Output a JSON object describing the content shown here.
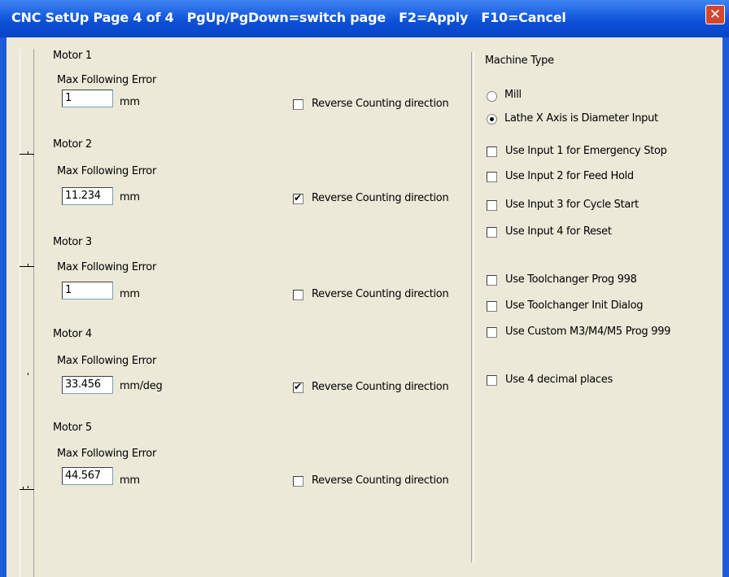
{
  "window": {
    "title": "CNC SetUp Page 4 of 4   PgUp/PgDown=switch page   F2=Apply   F10=Cancel",
    "close_glyph": "✕"
  },
  "motors": [
    {
      "label": "Motor 1",
      "error_label": "Max Following Error",
      "value": "1",
      "unit": "mm",
      "reverse_label": "Reverse Counting direction",
      "reverse_checked": false
    },
    {
      "label": "Motor 2",
      "error_label": "Max Following Error",
      "value": "11.234",
      "unit": "mm",
      "reverse_label": "Reverse Counting direction",
      "reverse_checked": true
    },
    {
      "label": "Motor 3",
      "error_label": "Max Following Error",
      "value": "1",
      "unit": "mm",
      "reverse_label": "Reverse Counting direction",
      "reverse_checked": false
    },
    {
      "label": "Motor 4",
      "error_label": "Max Following Error",
      "value": "33.456",
      "unit": "mm/deg",
      "reverse_label": "Reverse Counting direction",
      "reverse_checked": true
    },
    {
      "label": "Motor 5",
      "error_label": "Max Following Error",
      "value": "44.567",
      "unit": "mm",
      "reverse_label": "Reverse Counting direction",
      "reverse_checked": false
    }
  ],
  "machine": {
    "heading": "Machine Type",
    "mill_label": "Mill",
    "mill_selected": false,
    "lathe_label": "Lathe X Axis is Diameter Input",
    "lathe_selected": true
  },
  "options": [
    {
      "label": "Use Input 1 for Emergency Stop",
      "checked": false
    },
    {
      "label": "Use Input 2 for Feed Hold",
      "checked": false
    },
    {
      "label": "Use Input 3 for Cycle Start",
      "checked": false
    },
    {
      "label": "Use Input 4 for Reset",
      "checked": false
    },
    {
      "label": "Use Toolchanger Prog 998",
      "checked": false
    },
    {
      "label": "Use Toolchanger Init Dialog",
      "checked": false
    },
    {
      "label": "Use Custom M3/M4/M5 Prog 999",
      "checked": false
    },
    {
      "label": "Use 4 decimal places",
      "checked": false
    }
  ],
  "colors": {
    "titlebar": "#0a4fd6",
    "dialog_bg": "#ece9d8",
    "close_button": "#d6452f"
  }
}
